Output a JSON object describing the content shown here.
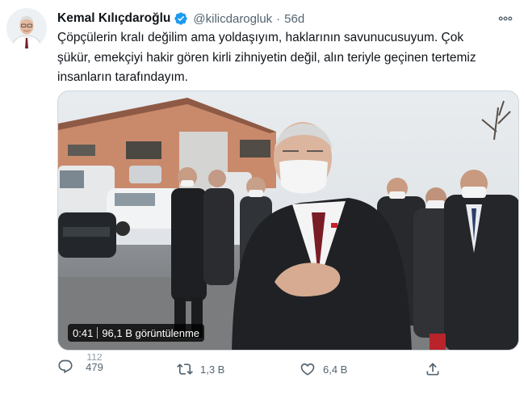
{
  "user": {
    "name": "Kemal Kılıçdaroğlu",
    "handle": "@kilicdarogluk",
    "separator": "·",
    "time": "56d"
  },
  "tweet": {
    "line1": "Çöpçülerin kralı değilim ama yoldaşıyım, haklarının savunucusuyum. Çok",
    "line2": "şükür, emekçiyi hakir gören kirli zihniyetin değil, alın teriyle geçinen tertemiz",
    "line3": "insanların tarafındayım."
  },
  "video": {
    "duration": "0:41",
    "views": "96,1 B görüntülenme"
  },
  "actions": {
    "reply_ghost": "112",
    "reply_count": "479",
    "retweet_count": "1,3 B",
    "like_count": "6,4 B"
  },
  "icons": {
    "verified": "verified-badge-icon",
    "more": "more-icon",
    "reply": "reply-icon",
    "retweet": "retweet-icon",
    "like": "heart-icon",
    "share": "share-icon"
  },
  "colors": {
    "verified_blue": "#1d9bf0",
    "text_primary": "#0f1419",
    "text_secondary": "#536471"
  }
}
